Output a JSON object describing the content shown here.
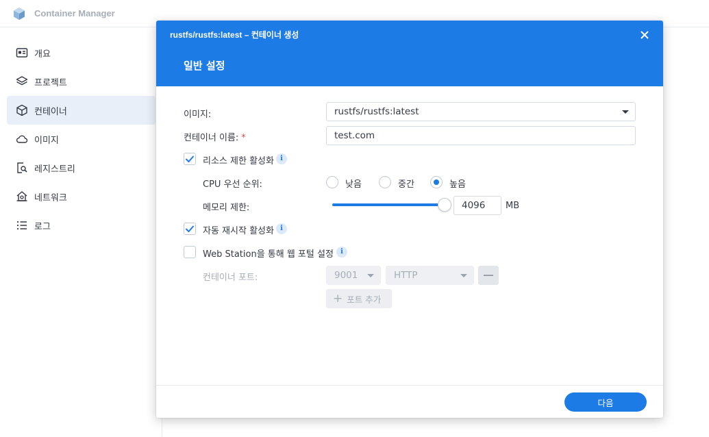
{
  "app": {
    "title": "Container Manager"
  },
  "sidebar": {
    "items": [
      {
        "label": "개요",
        "icon": "overview-icon"
      },
      {
        "label": "프로젝트",
        "icon": "layers-icon"
      },
      {
        "label": "컨테이너",
        "icon": "cube-icon",
        "active": true
      },
      {
        "label": "이미지",
        "icon": "cloud-icon"
      },
      {
        "label": "레지스트리",
        "icon": "registry-search-icon"
      },
      {
        "label": "네트워크",
        "icon": "network-home-icon"
      },
      {
        "label": "로그",
        "icon": "list-icon"
      }
    ]
  },
  "modal": {
    "subtitle": "rustfs/rustfs:latest – 컨테이너 생성",
    "title": "일반 설정",
    "close_icon": "close-icon",
    "header_color": "#1d7be6",
    "form": {
      "image_label": "이미지:",
      "image_value": "rustfs/rustfs:latest",
      "container_name_label": "컨테이너 이름:",
      "container_name_required": "*",
      "container_name_value": "test.com",
      "resource_limit_label": "리소스 제한 활성화",
      "resource_limit_checked": true,
      "cpu_priority_label": "CPU 우선 순위:",
      "cpu_options": [
        "낮음",
        "중간",
        "높음"
      ],
      "cpu_selected": "높음",
      "memory_limit_label": "메모리 제한:",
      "memory_value": "4096",
      "memory_unit": "MB",
      "memory_slider_fraction": 1.0,
      "auto_restart_label": "자동 재시작 활성화",
      "auto_restart_checked": true,
      "web_station_label": "Web Station을 통해 웹 포털 설정",
      "web_station_checked": false,
      "container_port_label": "컨테이너 포트:",
      "port_value": "9001",
      "protocol_value": "HTTP",
      "add_port_label": "포트 추가",
      "info_glyph": "i"
    },
    "footer": {
      "next_label": "다음"
    }
  }
}
